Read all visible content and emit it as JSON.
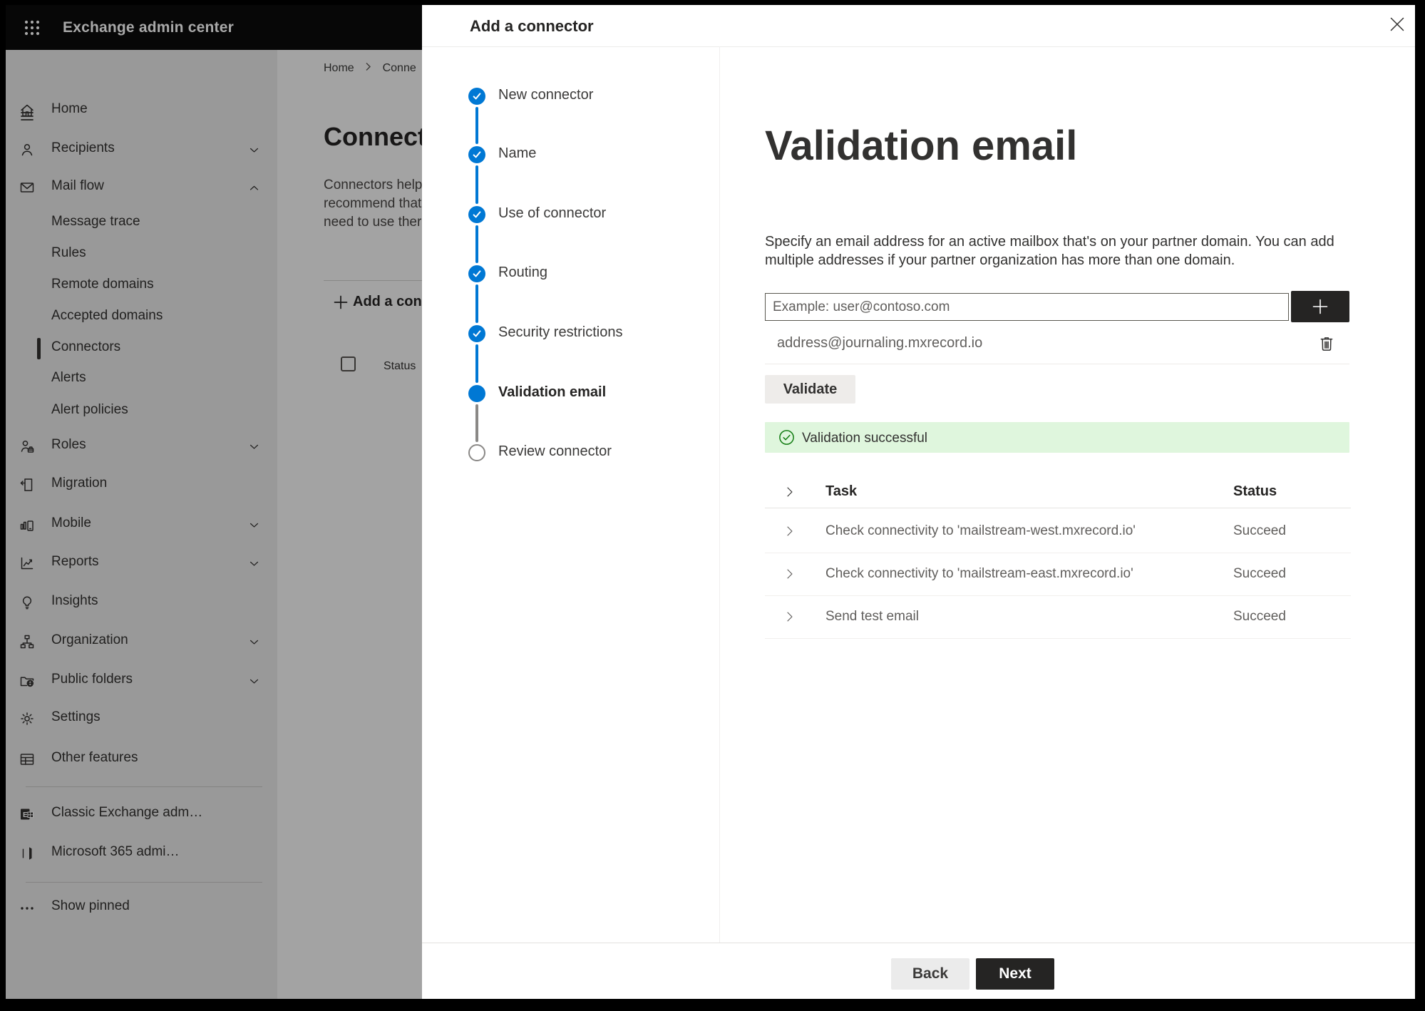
{
  "topbar": {
    "title": "Exchange admin center"
  },
  "sidebar": {
    "items": [
      {
        "label": "Home",
        "icon": "home-icon"
      },
      {
        "label": "Recipients",
        "icon": "recipients-icon",
        "chevron": "down"
      },
      {
        "label": "Mail flow",
        "icon": "mail-flow-icon",
        "chevron": "up"
      },
      {
        "label": "Message trace",
        "sub": true
      },
      {
        "label": "Rules",
        "sub": true
      },
      {
        "label": "Remote domains",
        "sub": true
      },
      {
        "label": "Accepted domains",
        "sub": true
      },
      {
        "label": "Connectors",
        "sub": true,
        "selected": true
      },
      {
        "label": "Alerts",
        "sub": true
      },
      {
        "label": "Alert policies",
        "sub": true
      },
      {
        "label": "Roles",
        "icon": "roles-icon",
        "chevron": "down"
      },
      {
        "label": "Migration",
        "icon": "migration-icon"
      },
      {
        "label": "Mobile",
        "icon": "mobile-icon",
        "chevron": "down"
      },
      {
        "label": "Reports",
        "icon": "reports-icon",
        "chevron": "down"
      },
      {
        "label": "Insights",
        "icon": "insights-icon"
      },
      {
        "label": "Organization",
        "icon": "organization-icon",
        "chevron": "down"
      },
      {
        "label": "Public folders",
        "icon": "public-folders-icon",
        "chevron": "down"
      },
      {
        "label": "Settings",
        "icon": "settings-icon"
      },
      {
        "label": "Other features",
        "icon": "other-features-icon"
      }
    ],
    "footer_items": [
      {
        "label": "Classic Exchange adm…",
        "icon": "classic-exchange-icon"
      },
      {
        "label": "Microsoft 365 admi…",
        "icon": "microsoft-365-icon"
      }
    ],
    "show_pinned_label": "Show pinned"
  },
  "page": {
    "breadcrumb": [
      "Home",
      "Conne"
    ],
    "title": "Connect",
    "description_lines": [
      "Connectors help",
      "recommend that",
      "need to use ther"
    ],
    "add_button_label": "Add a conn",
    "list_header": "Status"
  },
  "dialog": {
    "title": "Add a connector",
    "steps": [
      {
        "label": "New connector",
        "state": "done"
      },
      {
        "label": "Name",
        "state": "done"
      },
      {
        "label": "Use of connector",
        "state": "done"
      },
      {
        "label": "Routing",
        "state": "done"
      },
      {
        "label": "Security restrictions",
        "state": "done"
      },
      {
        "label": "Validation email",
        "state": "current"
      },
      {
        "label": "Review connector",
        "state": "upcoming"
      }
    ],
    "heading": "Validation email",
    "description": "Specify an email address for an active mailbox that's on your partner domain. You can add multiple addresses if your partner organization has more than one domain.",
    "email_input_placeholder": "Example: user@contoso.com",
    "added_address": "address@journaling.mxrecord.io",
    "validate_button_label": "Validate",
    "success_message": "Validation successful",
    "results_table": {
      "columns": [
        "Task",
        "Status"
      ],
      "rows": [
        {
          "task": "Check connectivity to 'mailstream-west.mxrecord.io'",
          "status": "Succeed"
        },
        {
          "task": "Check connectivity to 'mailstream-east.mxrecord.io'",
          "status": "Succeed"
        },
        {
          "task": "Send test email",
          "status": "Succeed"
        }
      ]
    },
    "back_button_label": "Back",
    "next_button_label": "Next"
  },
  "colors": {
    "accent": "#0078d4",
    "success_bg": "#dff6dd",
    "success_icon": "#107c10",
    "dark_button": "#252423",
    "text_primary": "#323130",
    "text_secondary": "#605e5c"
  }
}
